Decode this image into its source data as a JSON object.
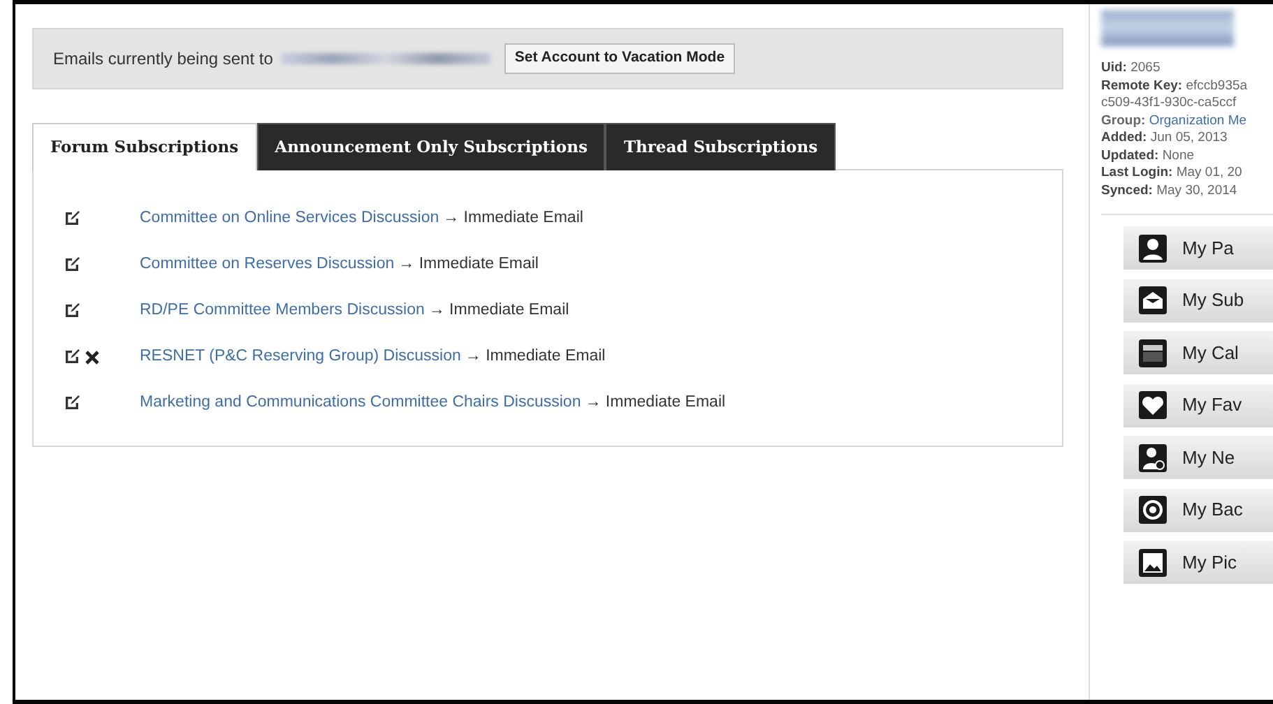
{
  "notice": {
    "text": "Emails currently being sent to",
    "button": "Set Account to Vacation Mode"
  },
  "tabs": [
    {
      "label": "Forum Subscriptions",
      "selected": true
    },
    {
      "label": "Announcement Only Subscriptions",
      "selected": false
    },
    {
      "label": "Thread Subscriptions",
      "selected": false
    }
  ],
  "subscriptions": [
    {
      "forum": "Committee on Online Services Discussion",
      "delivery": "→ Immediate Email",
      "removable": false
    },
    {
      "forum": "Committee on Reserves Discussion",
      "delivery": "→ Immediate Email",
      "removable": false
    },
    {
      "forum": "RD/PE Committee Members Discussion",
      "delivery": "→ Immediate Email",
      "removable": false
    },
    {
      "forum": "RESNET (P&C Reserving Group) Discussion",
      "delivery": "→ Immediate Email",
      "removable": true
    },
    {
      "forum": "Marketing and Communications Committee Chairs Discussion",
      "delivery": "→ Immediate Email",
      "removable": false
    }
  ],
  "profile": {
    "details": [
      {
        "label": "Uid:",
        "value": "2065",
        "kind": "text"
      },
      {
        "label": "Remote Key:",
        "value": "efccb935a",
        "kind": "text"
      },
      {
        "value": "c509-43f1-930c-ca5ccf",
        "kind": "text"
      },
      {
        "label": "Group:",
        "value": "Organization Me",
        "kind": "link"
      },
      {
        "label": "Added:",
        "value": "Jun 05, 2013",
        "kind": "text"
      },
      {
        "label": "Updated:",
        "value": "None",
        "kind": "text"
      },
      {
        "label": "Last Login:",
        "value": "May 01, 20",
        "kind": "text"
      },
      {
        "label": "Synced:",
        "value": "May 30, 2014",
        "kind": "text"
      }
    ]
  },
  "menu": [
    {
      "label": "My Pa",
      "kind": "page"
    },
    {
      "label": "My Sub",
      "kind": "subscriptions"
    },
    {
      "label": "My Cal",
      "kind": "calendar"
    },
    {
      "label": "My Fav",
      "kind": "favorites"
    },
    {
      "label": "My Ne",
      "kind": "network"
    },
    {
      "label": "My Bac",
      "kind": "badges"
    },
    {
      "label": "My Pic",
      "kind": "pictures"
    }
  ]
}
